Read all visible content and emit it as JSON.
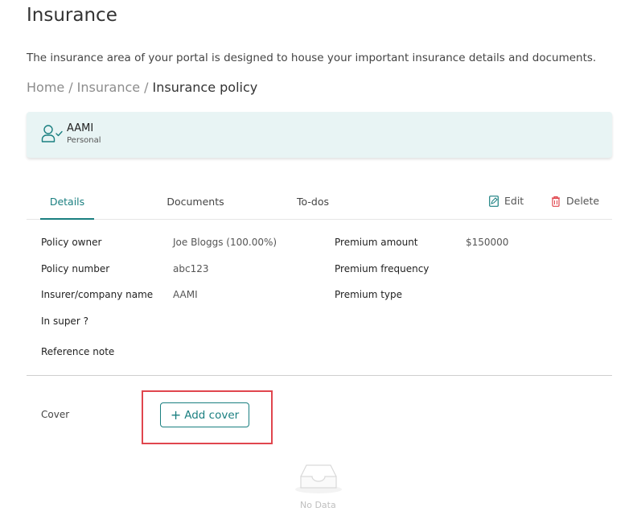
{
  "page": {
    "title": "Insurance",
    "intro": "The insurance area of your portal is designed to house your important insurance details and documents."
  },
  "breadcrumb": {
    "items": [
      "Home",
      "Insurance",
      "Insurance policy"
    ],
    "separator": "/"
  },
  "policy_card": {
    "name": "AAMI",
    "kind": "Personal",
    "icon": "user-check-icon"
  },
  "tabs": {
    "details": "Details",
    "documents": "Documents",
    "todos": "To-dos",
    "active": "Details"
  },
  "actions": {
    "edit": "Edit",
    "delete": "Delete"
  },
  "details": {
    "left": [
      {
        "label": "Policy owner",
        "value": "Joe Bloggs (100.00%)"
      },
      {
        "label": "Policy number",
        "value": "abc123"
      },
      {
        "label": "Insurer/company name",
        "value": "AAMI"
      },
      {
        "label": "In super ?",
        "value": ""
      },
      {
        "label": "Reference note",
        "value": ""
      }
    ],
    "right": [
      {
        "label": "Premium amount",
        "value": "$150000"
      },
      {
        "label": "Premium frequency",
        "value": ""
      },
      {
        "label": "Premium type",
        "value": ""
      }
    ]
  },
  "cover": {
    "label": "Cover",
    "add_button": "Add cover",
    "empty_text": "No Data"
  },
  "colors": {
    "accent": "#1a7f80",
    "card_bg": "#e8f4f4",
    "delete": "#e0464e",
    "highlight": "#e0464e"
  }
}
